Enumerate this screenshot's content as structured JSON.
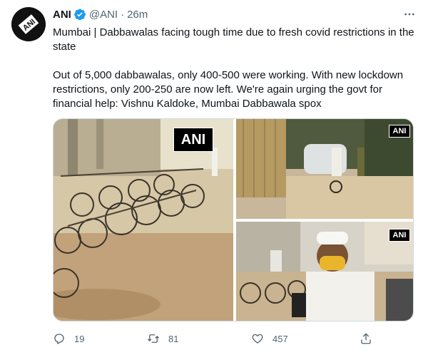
{
  "tweet": {
    "author_name": "ANI",
    "handle": "@ANI",
    "separator": "·",
    "time": "26m",
    "text_line1": "Mumbai | Dabbawalas facing tough time due to fresh covid restrictions in the state",
    "text_line2": "Out of 5,000 dabbawalas, only 400-500 were working. With new lockdown restrictions, only 200-250 are now left. We're again urging the govt for financial help: Vishnu Kaldoke, Mumbai Dabbawala spox",
    "watermark": "ANI",
    "icons": {
      "avatar": "ani-logo-avatar",
      "verified": "verified-badge-icon",
      "more": "more-options-icon",
      "reply": "reply-icon",
      "retweet": "retweet-icon",
      "like": "like-icon",
      "share": "share-icon"
    }
  },
  "actions": {
    "replies": "19",
    "retweets": "81",
    "likes": "457"
  },
  "colors": {
    "text": "#0f1419",
    "secondary": "#536471",
    "verified": "#1d9bf0"
  }
}
